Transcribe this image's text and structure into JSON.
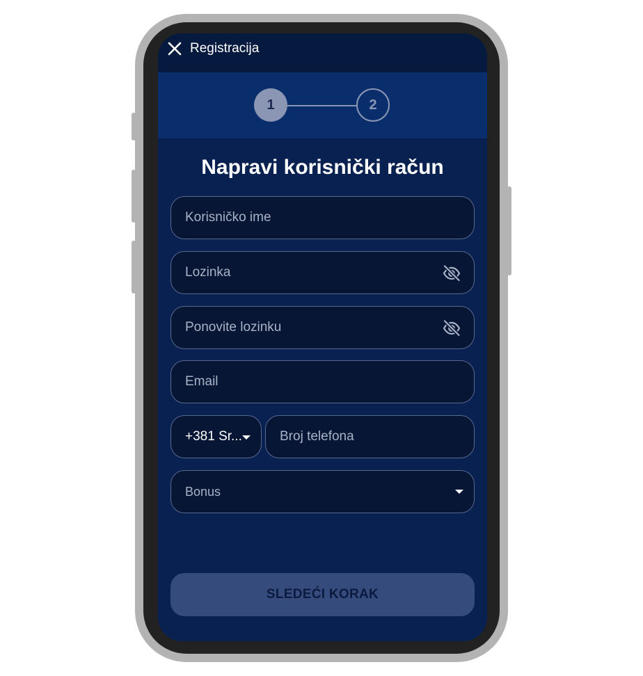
{
  "header": {
    "title": "Registracija",
    "close_icon": "close-icon"
  },
  "stepper": {
    "steps": [
      "1",
      "2"
    ],
    "current_step": 1
  },
  "page": {
    "title": "Napravi korisnički račun"
  },
  "form": {
    "username": {
      "placeholder": "Korisničko ime",
      "value": ""
    },
    "password": {
      "placeholder": "Lozinka",
      "value": "",
      "icon": "eye-off-icon"
    },
    "repeat_password": {
      "placeholder": "Ponovite lozinku",
      "value": "",
      "icon": "eye-off-icon"
    },
    "email": {
      "placeholder": "Email",
      "value": ""
    },
    "phone_code": {
      "value": "+381 Sr..."
    },
    "phone_number": {
      "placeholder": "Broj telefona",
      "value": ""
    },
    "bonus": {
      "label": "Bonus"
    }
  },
  "actions": {
    "next_label": "SLEDEĆI KORAK"
  },
  "colors": {
    "screen_bg": "#082150",
    "topbar_bg": "#061a3f",
    "stepper_bg": "#0a2e6b",
    "field_bg": "#061634",
    "button_bg": "#344b7c",
    "step_color": "#8a96b3"
  }
}
